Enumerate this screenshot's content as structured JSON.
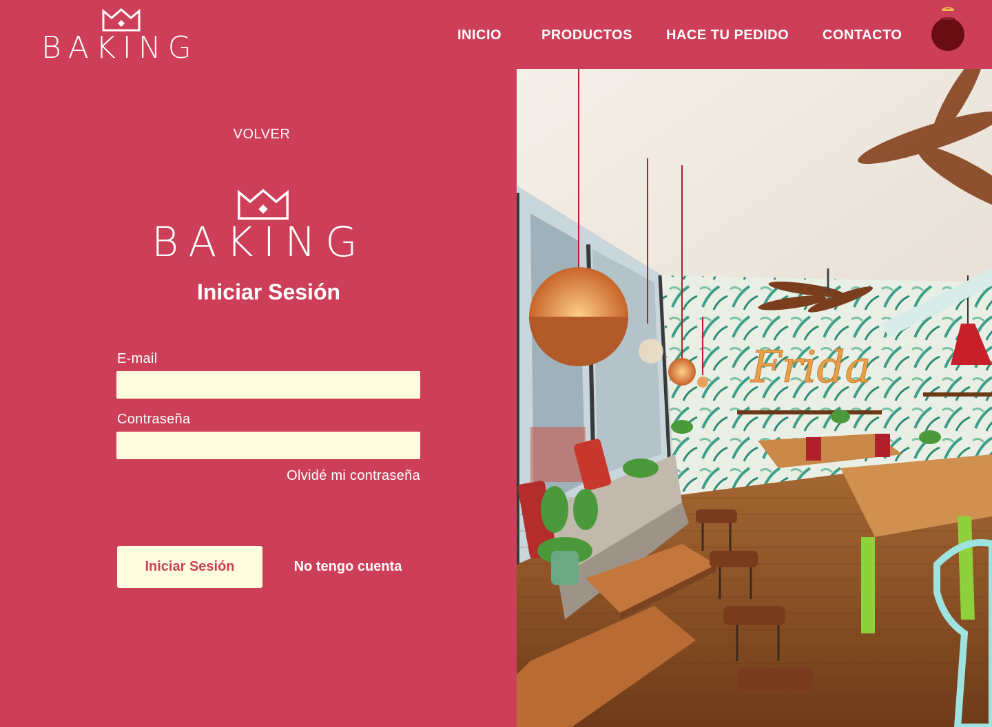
{
  "brand": {
    "name": "BAKING"
  },
  "nav": {
    "items": [
      "INICIO",
      "PRODUCTOS",
      "HACE TU PEDIDO",
      "CONTACTO"
    ]
  },
  "login": {
    "back_label": "VOLVER",
    "logo_text": "BAKING",
    "title": "Iniciar Sesión",
    "email_label": "E-mail",
    "email_value": "",
    "password_label": "Contraseña",
    "password_value": "",
    "forgot_label": "Olvidé mi contraseña",
    "submit_label": "Iniciar Sesión",
    "register_label": "No tengo cuenta"
  },
  "photo": {
    "sign_text": "Frida"
  },
  "colors": {
    "background": "#cd3f58",
    "input_fill": "#fffddd",
    "cart_button": "#6a0d12",
    "text": "#ffffff"
  },
  "icons": {
    "brand": "crown-icon",
    "cart": "cart-pot-icon"
  }
}
